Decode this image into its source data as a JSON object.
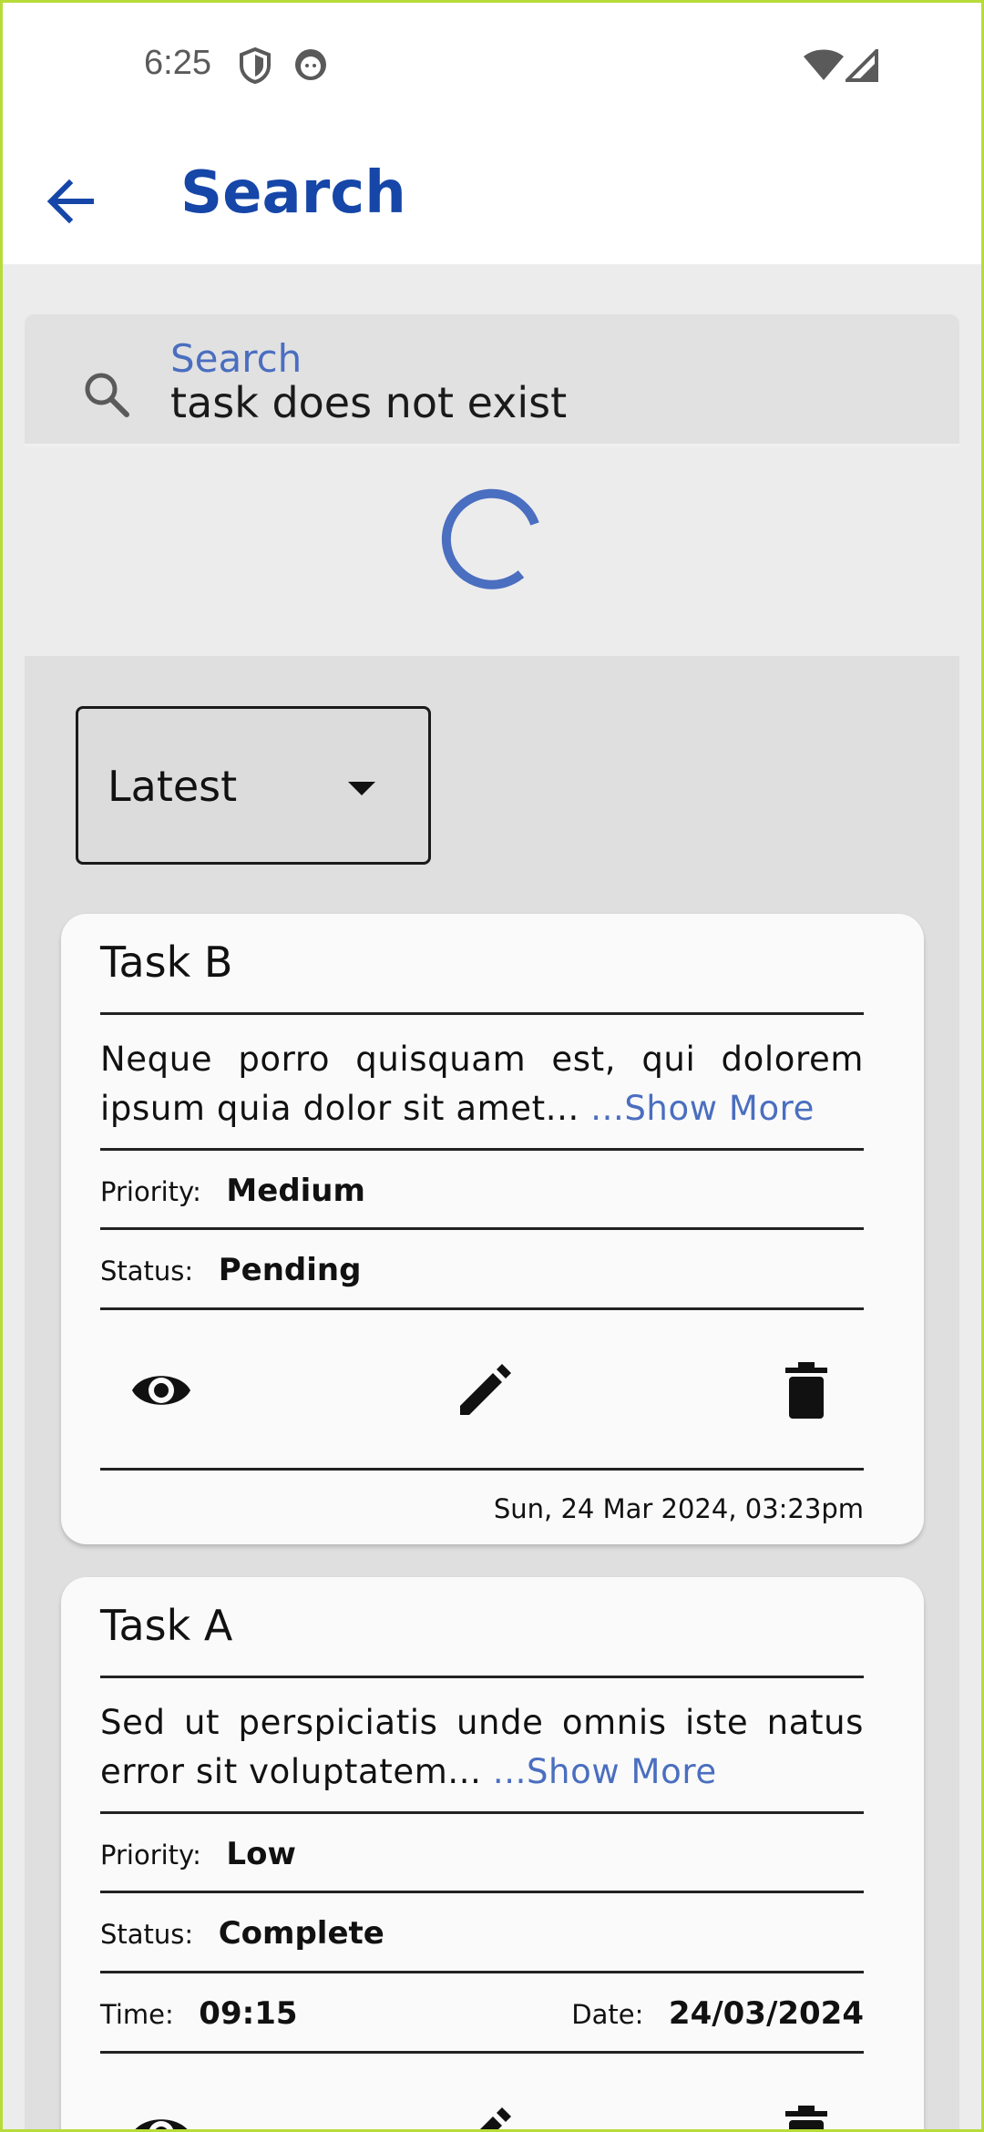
{
  "status_bar": {
    "time": "6:25",
    "icons": [
      "shield-icon",
      "face-icon",
      "wifi-icon",
      "signal-icon"
    ]
  },
  "app_bar": {
    "title": "Search",
    "back_icon": "arrow-back-icon",
    "title_color": "#1546a8"
  },
  "search": {
    "label": "Search",
    "value": "task does not exist",
    "icon": "search-icon"
  },
  "loading": {
    "icon": "progress-spinner",
    "color": "#4a6ec0"
  },
  "sort": {
    "selected": "Latest"
  },
  "tasks": [
    {
      "title": "Task B",
      "description": "Neque porro quisquam est, qui dolorem ipsum quia dolor sit amet...",
      "show_more": "...Show More",
      "priority_label": "Priority:",
      "priority": "Medium",
      "status_label": "Status:",
      "status": "Pending",
      "date": "Sun, 24 Mar 2024, 03:23pm"
    },
    {
      "title": "Task A",
      "description": "Sed ut perspiciatis unde omnis iste natus error sit voluptatem...",
      "show_more": "...Show More",
      "priority_label": "Priority:",
      "priority": "Low",
      "status_label": "Status:",
      "status": "Complete",
      "time_label": "Time:",
      "time": "09:15",
      "date_label": "Date:",
      "date_value": "24/03/2024"
    }
  ],
  "accent_color": "#4a6ec0"
}
